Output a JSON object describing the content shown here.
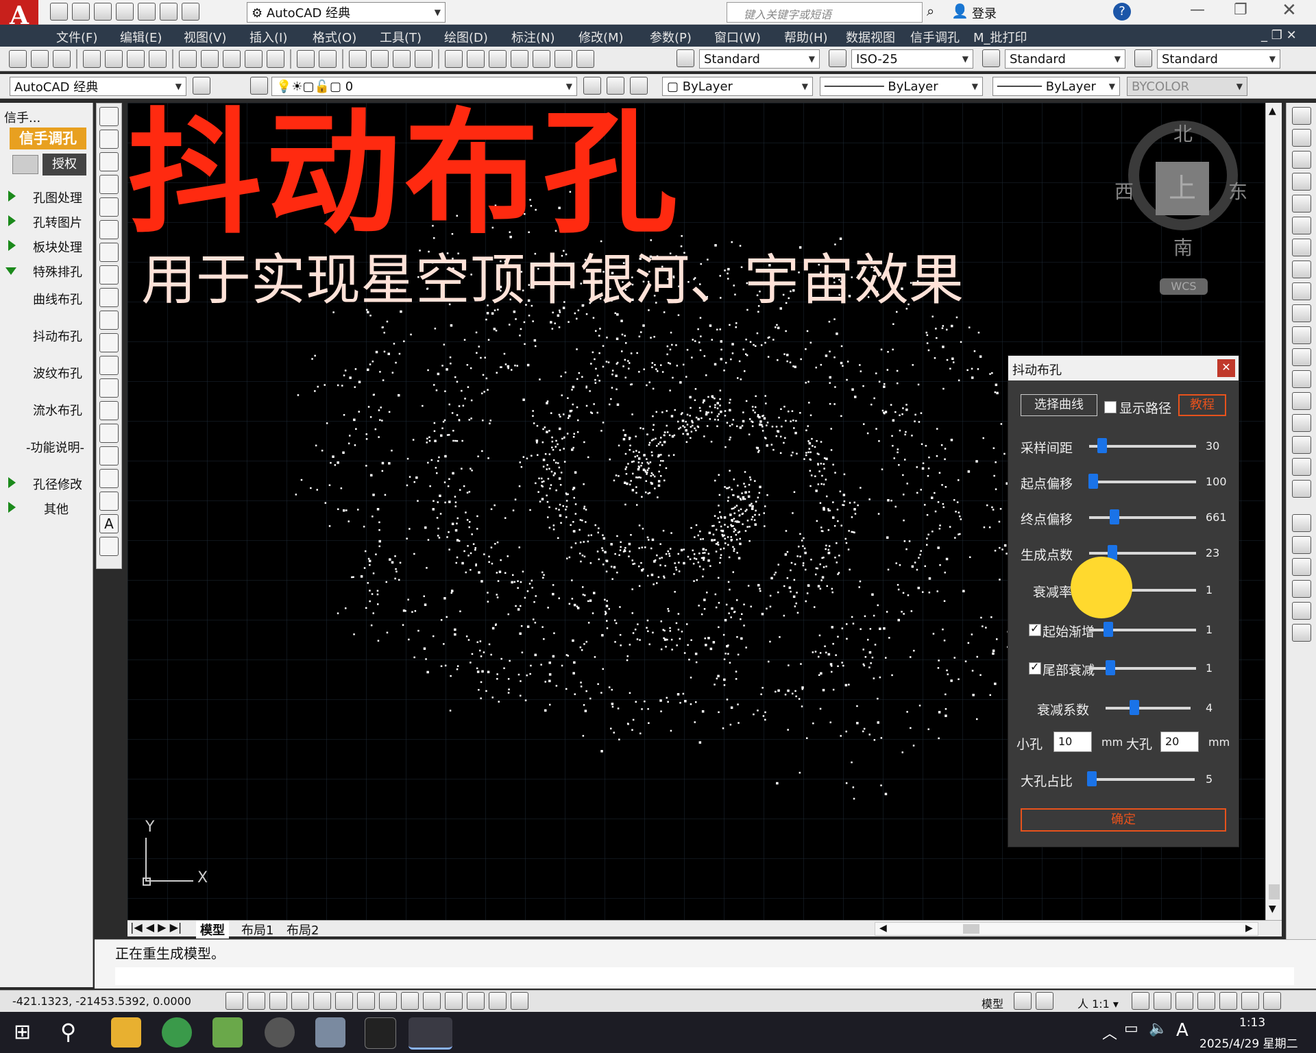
{
  "window": {
    "app_name": "AutoCAD 经典",
    "search_placeholder": "键入关键字或短语",
    "login": "登录"
  },
  "menu": [
    "文件(F)",
    "编辑(E)",
    "视图(V)",
    "插入(I)",
    "格式(O)",
    "工具(T)",
    "绘图(D)",
    "标注(N)",
    "修改(M)",
    "参数(P)",
    "窗口(W)",
    "帮助(H)",
    "数据视图",
    "信手调孔",
    "M_批打印"
  ],
  "toolbar1": {
    "text_style": "Standard",
    "dim_style": "ISO-25",
    "table_style": "Standard",
    "mleader_style": "Standard"
  },
  "toolbar2": {
    "workspace": "AutoCAD 经典",
    "layer": "0",
    "color": "ByLayer",
    "linetype": "ByLayer",
    "lineweight": "ByLayer",
    "plotstyle": "BYCOLOR"
  },
  "left_panel": {
    "header": "信手...",
    "brand": "信手调孔",
    "auth_button": "授权",
    "items": [
      {
        "label": "孔图处理",
        "arrow": "right"
      },
      {
        "label": "孔转图片",
        "arrow": "right"
      },
      {
        "label": "板块处理",
        "arrow": "right"
      },
      {
        "label": "特殊排孔",
        "arrow": "down"
      },
      {
        "label": "曲线布孔",
        "arrow": "none"
      },
      {
        "label": "抖动布孔",
        "arrow": "none"
      },
      {
        "label": "波纹布孔",
        "arrow": "none"
      },
      {
        "label": "流水布孔",
        "arrow": "none"
      },
      {
        "label": "-功能说明-",
        "arrow": "none"
      },
      {
        "label": "孔径修改",
        "arrow": "right"
      },
      {
        "label": "其他",
        "arrow": "right"
      }
    ]
  },
  "overlay": {
    "title": "抖动布孔",
    "subtitle": "用于实现星空顶中银河、宇宙效果",
    "title_color": "#ff2a10",
    "subtitle_color": "#ffe2d8"
  },
  "viewcube": {
    "north": "北",
    "south": "南",
    "east": "东",
    "west": "西",
    "top": "上",
    "wcs": "WCS"
  },
  "ucs": {
    "x": "X",
    "y": "Y"
  },
  "dialog": {
    "title": "抖动布孔",
    "select_curve": "选择曲线",
    "show_path": "显示路径",
    "show_path_checked": false,
    "tutorial": "教程",
    "sliders": [
      {
        "label": "采样间距",
        "value": "30",
        "fraction": 0.12,
        "checkbox": null
      },
      {
        "label": "起点偏移",
        "value": "100",
        "fraction": 0.04,
        "checkbox": null
      },
      {
        "label": "终点偏移",
        "value": "661",
        "fraction": 0.24,
        "checkbox": null
      },
      {
        "label": "生成点数",
        "value": "23",
        "fraction": 0.22,
        "checkbox": null
      },
      {
        "label": "衰减率",
        "value": "1",
        "fraction": 0.08,
        "checkbox": null
      },
      {
        "label": "起始渐增",
        "value": "1",
        "fraction": 0.18,
        "checkbox": true
      },
      {
        "label": "尾部衰减",
        "value": "1",
        "fraction": 0.2,
        "checkbox": true
      },
      {
        "label": "衰减系数",
        "value": "4",
        "fraction": 0.34,
        "checkbox": null
      }
    ],
    "small_hole_label": "小孔",
    "small_hole_value": "10",
    "big_hole_label": "大孔",
    "big_hole_value": "20",
    "unit": "mm",
    "ratio_label": "大孔占比",
    "ratio_value": "5",
    "ratio_fraction": 0.04,
    "ok": "确定",
    "accent": "#e8521c"
  },
  "tabs": [
    "模型",
    "布局1",
    "布局2"
  ],
  "command_line": "正在重生成模型。",
  "status": {
    "coords": "-421.1323,  -21453.5392,  0.0000",
    "model": "模型",
    "scale": "1:1"
  },
  "taskbar": {
    "time": "1:13",
    "date": "2025/4/29 星期二",
    "ime": "A"
  }
}
